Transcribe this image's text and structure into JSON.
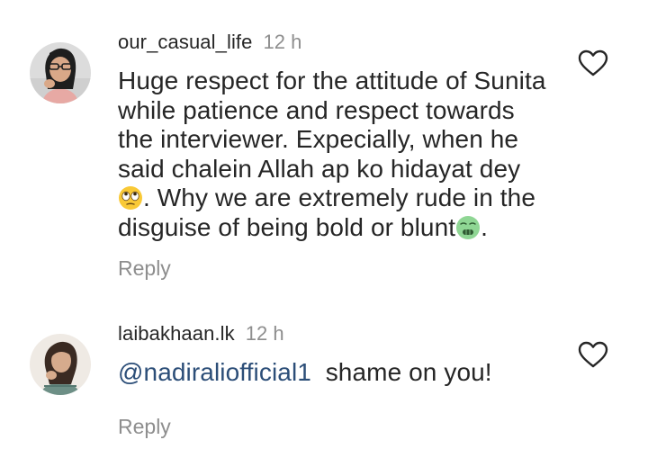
{
  "comments": [
    {
      "username": "our_casual_life",
      "time": "12 h",
      "text_line1": "Huge respect for the attitude of Sunita",
      "text_line2": "while patience and respect towards",
      "text_line3": "the interviewer. Expecially, when he",
      "text_line4": "said chalein Allah ap ko hidayat dey",
      "text_line5_after_emoji": ". Why we are extremely rude in the",
      "text_line6_before_emoji": "disguise of being bold or blunt",
      "text_line6_after_emoji": ".",
      "emoji_1": "face-with-rolling-eyes-emoji",
      "emoji_2": "nauseated-face-emoji",
      "reply_label": "Reply",
      "like_icon": "heart-outline-icon"
    },
    {
      "username": "laibakhaan.lk",
      "time": "12 h",
      "mention": "@nadiraliofficial1",
      "text": "shame on you!",
      "reply_label": "Reply",
      "like_icon": "heart-outline-icon"
    }
  ]
}
